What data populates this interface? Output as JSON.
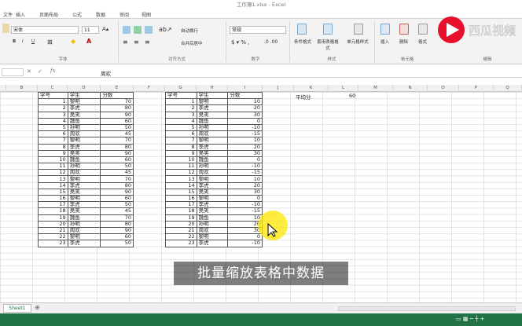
{
  "window": {
    "title": "工作簿1.xlsx - Excel"
  },
  "tabs": [
    "文件",
    "插入",
    "页面布局",
    "公式",
    "数据",
    "审阅",
    "视图"
  ],
  "ribbon": {
    "font_name": "宋体",
    "font_size": "11",
    "wrap_text": "自动换行",
    "merge_center": "合并后居中",
    "number_format": "常规",
    "cond_format": "条件格式",
    "format_table": "套用表格格式",
    "cell_style": "单元格样式",
    "insert": "插入",
    "delete": "删除",
    "format": "格式",
    "groups": {
      "font": "字体",
      "alignment": "对齐方式",
      "number": "数字",
      "styles": "样式",
      "cells": "单元格",
      "editing": "编辑"
    }
  },
  "formula_bar": {
    "value": "周欢"
  },
  "columns": [
    "B",
    "C",
    "D",
    "E",
    "F",
    "G",
    "H",
    "I",
    "J",
    "K",
    "L",
    "M",
    "N",
    "O",
    "P",
    "Q"
  ],
  "table1": {
    "headers": [
      "学号",
      "学生",
      "分数"
    ],
    "rows": [
      [
        1,
        "黎明",
        70
      ],
      [
        2,
        "李虎",
        80
      ],
      [
        3,
        "吴笑",
        90
      ],
      [
        4,
        "魏鱼",
        60
      ],
      [
        5,
        "孙明",
        50
      ],
      [
        6,
        "周欢",
        45
      ],
      [
        7,
        "黎明",
        70
      ],
      [
        8,
        "李虎",
        80
      ],
      [
        9,
        "吴笑",
        90
      ],
      [
        10,
        "魏鱼",
        60
      ],
      [
        11,
        "孙明",
        50
      ],
      [
        12,
        "周欢",
        45
      ],
      [
        13,
        "黎明",
        70
      ],
      [
        14,
        "李虎",
        80
      ],
      [
        15,
        "吴笑",
        90
      ],
      [
        16,
        "黎明",
        60
      ],
      [
        17,
        "李虎",
        50
      ],
      [
        18,
        "吴笑",
        45
      ],
      [
        19,
        "魏鱼",
        70
      ],
      [
        20,
        "孙明",
        80
      ],
      [
        21,
        "周欢",
        90
      ],
      [
        22,
        "黎明",
        60
      ],
      [
        23,
        "李虎",
        50
      ]
    ]
  },
  "table2": {
    "headers": [
      "学号",
      "学生",
      "分数"
    ],
    "rows": [
      [
        1,
        "黎明",
        10
      ],
      [
        2,
        "李虎",
        20
      ],
      [
        3,
        "吴笑",
        30
      ],
      [
        4,
        "魏鱼",
        0
      ],
      [
        5,
        "孙明",
        -10
      ],
      [
        6,
        "周欢",
        -15
      ],
      [
        7,
        "黎明",
        10
      ],
      [
        8,
        "李虎",
        20
      ],
      [
        9,
        "吴笑",
        30
      ],
      [
        10,
        "魏鱼",
        0
      ],
      [
        11,
        "孙明",
        -10
      ],
      [
        12,
        "周欢",
        -15
      ],
      [
        13,
        "黎明",
        10
      ],
      [
        14,
        "李虎",
        20
      ],
      [
        15,
        "吴笑",
        30
      ],
      [
        16,
        "黎明",
        0
      ],
      [
        17,
        "李虎",
        -10
      ],
      [
        18,
        "吴笑",
        -15
      ],
      [
        19,
        "魏鱼",
        10
      ],
      [
        20,
        "孙明",
        20
      ],
      [
        21,
        "周欢",
        30
      ],
      [
        22,
        "黎明",
        0
      ],
      [
        23,
        "李虎",
        -10
      ]
    ]
  },
  "average": {
    "label": "平均分",
    "value": "60"
  },
  "sheet_tab": "Sheet1",
  "subtitle": "批量缩放表格中数据",
  "logo_text": "西瓜视频",
  "colors": {
    "excel_green": "#217346",
    "logo_red": "#e8112d"
  }
}
